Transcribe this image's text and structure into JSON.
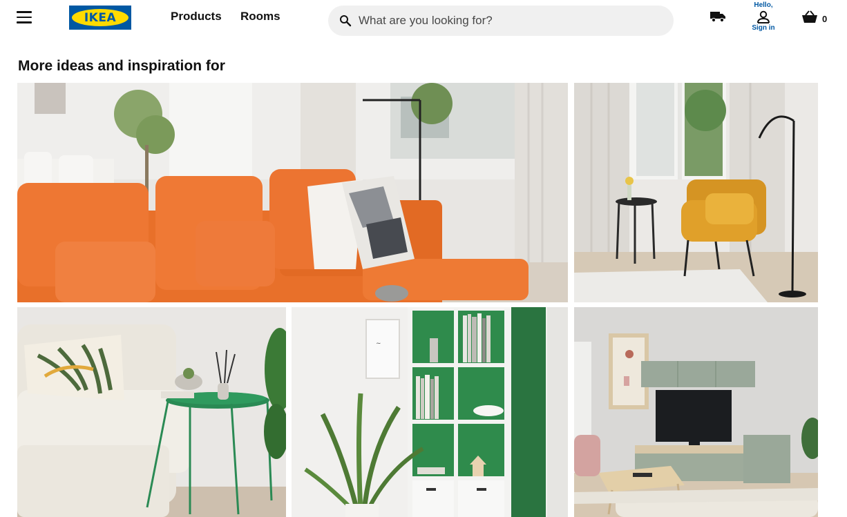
{
  "header": {
    "menu_icon": "hamburger-menu-icon",
    "logo": "IKEA",
    "nav": [
      {
        "label": "Products"
      },
      {
        "label": "Rooms"
      }
    ],
    "search": {
      "placeholder": "What are you looking for?",
      "value": "",
      "icon": "search-icon"
    },
    "delivery_icon": "truck-icon",
    "account": {
      "greeting": "Hello,",
      "signin": "Sign in",
      "icon": "person-icon"
    },
    "cart": {
      "icon": "basket-icon",
      "count": "0"
    }
  },
  "section": {
    "title": "More ideas and inspiration for",
    "tiles": [
      {
        "subject": "Orange sofa living room"
      },
      {
        "subject": "Mustard armchair with floor lamp"
      },
      {
        "subject": "Beige sofa with green side table"
      },
      {
        "subject": "Green shelving unit with plant"
      },
      {
        "subject": "TV storage combination living room"
      }
    ]
  },
  "colors": {
    "ikea_blue": "#0058a3",
    "ikea_yellow": "#ffdb00",
    "sofa_orange": "#e8702a",
    "chair_mustard": "#e0a02a",
    "shelf_green": "#2e7d46",
    "search_bg": "#f0f0f0"
  }
}
